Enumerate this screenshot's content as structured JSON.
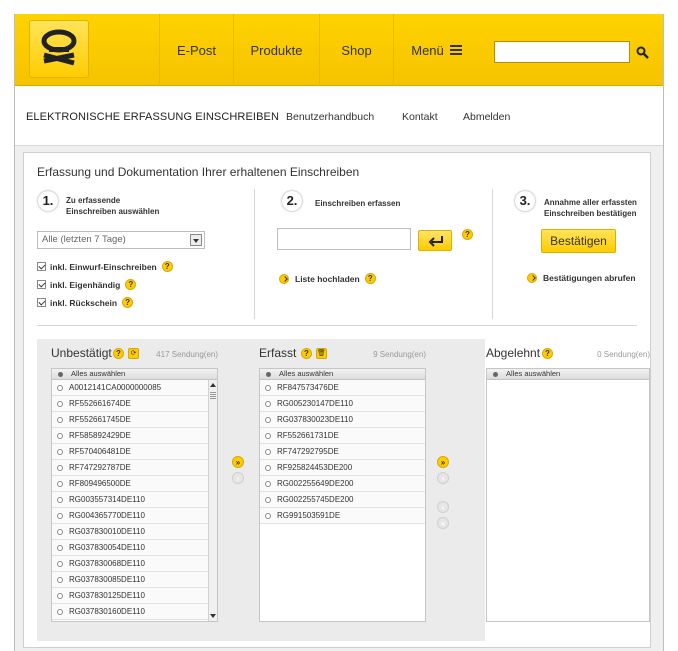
{
  "header": {
    "nav": [
      "E-Post",
      "Produkte",
      "Shop",
      "Menü"
    ],
    "search_placeholder": ""
  },
  "subnav": {
    "title": "ELEKTRONISCHE ERFASSUNG EINSCHREIBEN",
    "links": [
      "Benutzerhandbuch",
      "Kontakt",
      "Abmelden"
    ]
  },
  "panel": {
    "title": "Erfassung und Dokumentation Ihrer erhaltenen Einschreiben",
    "steps": [
      {
        "num": "1.",
        "line1": "Zu erfassende",
        "line2": "Einschreiben auswählen"
      },
      {
        "num": "2.",
        "line1": "Einschreiben erfassen",
        "line2": ""
      },
      {
        "num": "3.",
        "line1": "Annahme aller erfassten",
        "line2": "Einschreiben bestätigen"
      }
    ],
    "filter_value": "Alle (letzten 7 Tage)",
    "checkboxes": [
      "inkl. Einwurf-Einschreiben",
      "inkl. Eigenhändig",
      "inkl. Rückschein"
    ],
    "upload_link": "Liste hochladen",
    "confirm_button": "Bestätigen",
    "confirmations_link": "Bestätigungen abrufen"
  },
  "lists": {
    "select_all": "Alles auswählen",
    "unconfirmed": {
      "title": "Unbestätigt",
      "count": "417  Sendung(en)",
      "items": [
        "A0012141CA0000000085",
        "RF552661674DE",
        "RF552661745DE",
        "RF585892429DE",
        "RF570406481DE",
        "RF747292787DE",
        "RF809496500DE",
        "RG003557314DE110",
        "RG004365770DE110",
        "RG037830010DE110",
        "RG037830054DE110",
        "RG037830068DE110",
        "RG037830085DE110",
        "RG037830125DE110",
        "RG037830160DE110"
      ]
    },
    "captured": {
      "title": "Erfasst",
      "count": "9  Sendung(en)",
      "items": [
        "RF847573476DE",
        "RG005230147DE110",
        "RG037830023DE110",
        "RF552661731DE",
        "RF747292795DE",
        "RF925824453DE200",
        "RG002255649DE200",
        "RG002255745DE200",
        "RG991503591DE"
      ]
    },
    "rejected": {
      "title": "Abgelehnt",
      "count": "0  Sendung(en)",
      "items": []
    }
  },
  "colors": {
    "brand_yellow": "#ffcc00",
    "text": "#333333"
  }
}
